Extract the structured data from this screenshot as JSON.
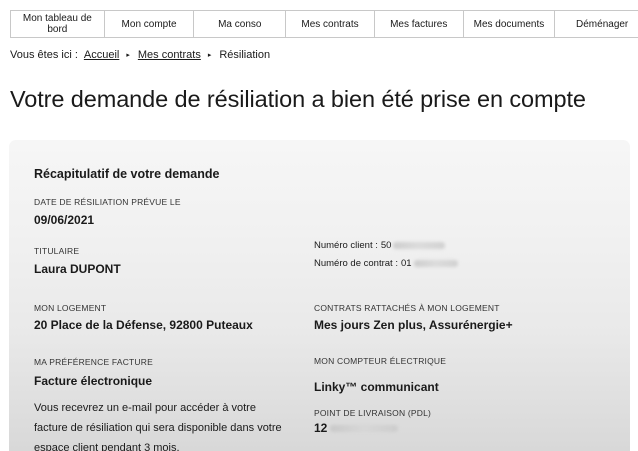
{
  "nav": {
    "items": [
      {
        "label": "Mon tableau de bord"
      },
      {
        "label": "Mon compte"
      },
      {
        "label": "Ma conso"
      },
      {
        "label": "Mes contrats"
      },
      {
        "label": "Mes factures"
      },
      {
        "label": "Mes documents"
      },
      {
        "label": "Déménager"
      }
    ]
  },
  "breadcrumb": {
    "prefix": "Vous êtes ici :",
    "home": "Accueil",
    "contracts": "Mes contrats",
    "current": "Résiliation",
    "separator": "▸"
  },
  "page": {
    "title": "Votre demande de résiliation a bien été prise en compte"
  },
  "recap": {
    "heading": "Récapitulatif de votre demande",
    "date_label": "DATE DE RÉSILIATION PRÉVUE LE",
    "date_value": "09/06/2021",
    "holder_label": "TITULAIRE",
    "holder_value": "Laura DUPONT",
    "client_number_label": "Numéro client :",
    "client_number_value": "50",
    "contract_number_label": "Numéro de contrat :",
    "contract_number_value": "01",
    "housing_label": "MON LOGEMENT",
    "housing_value": "20 Place de la Défense, 92800 Puteaux",
    "contracts_label": "CONTRATS RATTACHÉS À MON LOGEMENT",
    "contracts_value": "Mes jours Zen plus, Assurénergie+",
    "billing_label": "MA PRÉFÉRENCE FACTURE",
    "billing_value": "Facture électronique",
    "billing_note": "Vous recevrez un e-mail pour accéder à votre facture de résiliation qui sera disponible dans votre espace client pendant 3 mois.",
    "meter_label": "MON COMPTEUR ÉLECTRIQUE",
    "meter_value": "Linky™ communicant",
    "pdl_label": "POINT DE LIVRAISON (PDL)",
    "pdl_value": "12"
  }
}
